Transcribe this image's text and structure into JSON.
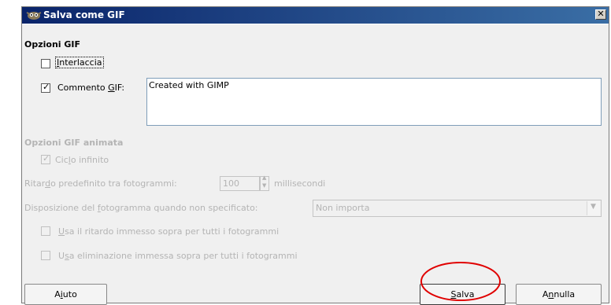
{
  "window": {
    "title": "Salva come GIF",
    "close_glyph": "✕"
  },
  "gif_options": {
    "section_title": "Opzioni GIF",
    "interlace": {
      "label_pre": "",
      "label_ul": "I",
      "label_post": "nterlaccia",
      "checked": false
    },
    "comment": {
      "label_pre": "Commento ",
      "label_ul": "G",
      "label_post": "IF:",
      "checked": true,
      "value": "Created with GIMP"
    }
  },
  "animated_options": {
    "section_title": "Opzioni GIF animata",
    "loop": {
      "label_pre": "Cic",
      "label_ul": "l",
      "label_post": "o infinito",
      "checked": true,
      "enabled": false
    },
    "delay": {
      "label_pre": "Ritar",
      "label_ul": "d",
      "label_post": "o predefinito tra fotogrammi:",
      "value": "100",
      "unit": "millisecondi"
    },
    "disposal": {
      "label_pre": "Disposizione del ",
      "label_ul": "f",
      "label_post": "otogramma quando non specificato:",
      "value": "Non importa"
    },
    "use_delay": {
      "label_pre": "",
      "label_ul": "U",
      "label_post": "sa il ritardo immesso sopra per tutti i fotogrammi",
      "checked": false
    },
    "use_disposal": {
      "label_pre": "U",
      "label_ul": "s",
      "label_post": "a eliminazione immessa sopra per tutti i fotogrammi",
      "checked": false
    }
  },
  "buttons": {
    "help": {
      "label_pre": "A",
      "label_ul": "i",
      "label_post": "uto"
    },
    "save": {
      "label_pre": "",
      "label_ul": "S",
      "label_post": "alva"
    },
    "cancel": {
      "label_pre": "A",
      "label_ul": "n",
      "label_post": "nulla"
    }
  },
  "colors": {
    "title_bar": "#0a246a",
    "disabled_text": "#b4b4b4",
    "annotation_circle": "#e00000"
  }
}
